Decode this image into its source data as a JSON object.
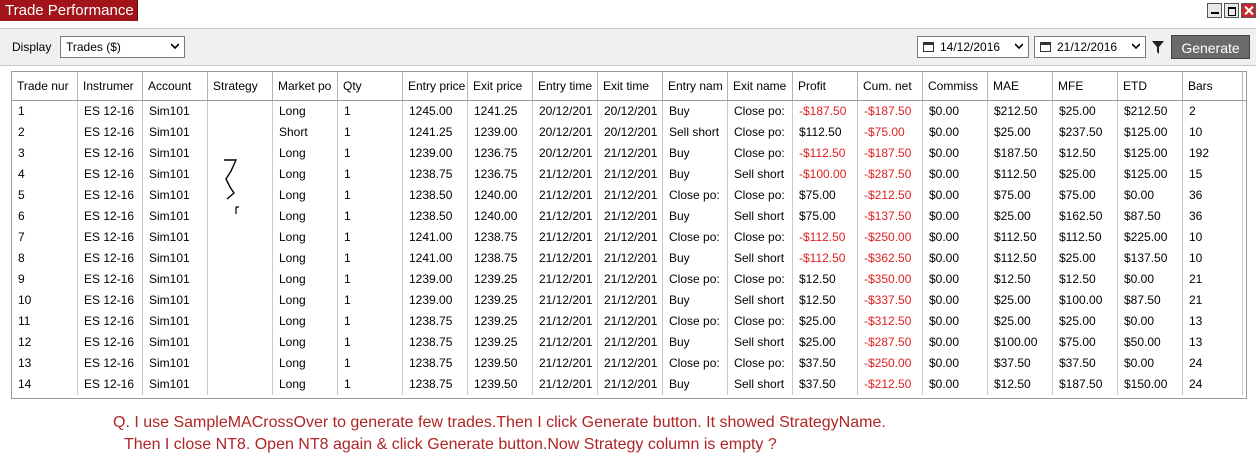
{
  "window": {
    "title": "Trade Performance"
  },
  "toolbar": {
    "display_label": "Display",
    "display_value": "Trades ($)",
    "from_date": "14/12/2016",
    "to_date": "21/12/2016",
    "generate_label": "Generate"
  },
  "columns": [
    "Trade nur",
    "Instrumer",
    "Account",
    "Strategy",
    "Market po",
    "Qty",
    "Entry price",
    "Exit price",
    "Entry time",
    "Exit time",
    "Entry nam",
    "Exit name",
    "Profit",
    "Cum. net",
    "Commiss",
    "MAE",
    "MFE",
    "ETD",
    "Bars"
  ],
  "rows": [
    [
      "1",
      "ES 12-16",
      "Sim101",
      "",
      "Long",
      "1",
      "1245.00",
      "1241.25",
      "20/12/201",
      "20/12/201",
      "Buy",
      "Close po:",
      "-$187.50",
      "-$187.50",
      "$0.00",
      "$212.50",
      "$25.00",
      "$212.50",
      "2"
    ],
    [
      "2",
      "ES 12-16",
      "Sim101",
      "",
      "Short",
      "1",
      "1241.25",
      "1239.00",
      "20/12/201",
      "20/12/201",
      "Sell short",
      "Close po:",
      "$112.50",
      "-$75.00",
      "$0.00",
      "$25.00",
      "$237.50",
      "$125.00",
      "10"
    ],
    [
      "3",
      "ES 12-16",
      "Sim101",
      "",
      "Long",
      "1",
      "1239.00",
      "1236.75",
      "20/12/201",
      "21/12/201",
      "Buy",
      "Close po:",
      "-$112.50",
      "-$187.50",
      "$0.00",
      "$187.50",
      "$12.50",
      "$125.00",
      "192"
    ],
    [
      "4",
      "ES 12-16",
      "Sim101",
      "",
      "Long",
      "1",
      "1238.75",
      "1236.75",
      "21/12/201",
      "21/12/201",
      "Buy",
      "Sell short",
      "-$100.00",
      "-$287.50",
      "$0.00",
      "$112.50",
      "$25.00",
      "$125.00",
      "15"
    ],
    [
      "5",
      "ES 12-16",
      "Sim101",
      "",
      "Long",
      "1",
      "1238.50",
      "1240.00",
      "21/12/201",
      "21/12/201",
      "Close po:",
      "Close po:",
      "$75.00",
      "-$212.50",
      "$0.00",
      "$75.00",
      "$75.00",
      "$0.00",
      "36"
    ],
    [
      "6",
      "ES 12-16",
      "Sim101",
      "",
      "Long",
      "1",
      "1238.50",
      "1240.00",
      "21/12/201",
      "21/12/201",
      "Buy",
      "Sell short",
      "$75.00",
      "-$137.50",
      "$0.00",
      "$25.00",
      "$162.50",
      "$87.50",
      "36"
    ],
    [
      "7",
      "ES 12-16",
      "Sim101",
      "",
      "Long",
      "1",
      "1241.00",
      "1238.75",
      "21/12/201",
      "21/12/201",
      "Close po:",
      "Close po:",
      "-$112.50",
      "-$250.00",
      "$0.00",
      "$112.50",
      "$112.50",
      "$225.00",
      "10"
    ],
    [
      "8",
      "ES 12-16",
      "Sim101",
      "",
      "Long",
      "1",
      "1241.00",
      "1238.75",
      "21/12/201",
      "21/12/201",
      "Buy",
      "Sell short",
      "-$112.50",
      "-$362.50",
      "$0.00",
      "$112.50",
      "$25.00",
      "$137.50",
      "10"
    ],
    [
      "9",
      "ES 12-16",
      "Sim101",
      "",
      "Long",
      "1",
      "1239.00",
      "1239.25",
      "21/12/201",
      "21/12/201",
      "Close po:",
      "Close po:",
      "$12.50",
      "-$350.00",
      "$0.00",
      "$12.50",
      "$12.50",
      "$0.00",
      "21"
    ],
    [
      "10",
      "ES 12-16",
      "Sim101",
      "",
      "Long",
      "1",
      "1239.00",
      "1239.25",
      "21/12/201",
      "21/12/201",
      "Buy",
      "Sell short",
      "$12.50",
      "-$337.50",
      "$0.00",
      "$25.00",
      "$100.00",
      "$87.50",
      "21"
    ],
    [
      "11",
      "ES 12-16",
      "Sim101",
      "",
      "Long",
      "1",
      "1238.75",
      "1239.25",
      "21/12/201",
      "21/12/201",
      "Close po:",
      "Close po:",
      "$25.00",
      "-$312.50",
      "$0.00",
      "$25.00",
      "$25.00",
      "$0.00",
      "13"
    ],
    [
      "12",
      "ES 12-16",
      "Sim101",
      "",
      "Long",
      "1",
      "1238.75",
      "1239.25",
      "21/12/201",
      "21/12/201",
      "Buy",
      "Sell short",
      "$25.00",
      "-$287.50",
      "$0.00",
      "$100.00",
      "$75.00",
      "$50.00",
      "13"
    ],
    [
      "13",
      "ES 12-16",
      "Sim101",
      "",
      "Long",
      "1",
      "1238.75",
      "1239.50",
      "21/12/201",
      "21/12/201",
      "Close po:",
      "Close po:",
      "$37.50",
      "-$250.00",
      "$0.00",
      "$37.50",
      "$37.50",
      "$0.00",
      "24"
    ],
    [
      "14",
      "ES 12-16",
      "Sim101",
      "",
      "Long",
      "1",
      "1238.75",
      "1239.50",
      "21/12/201",
      "21/12/201",
      "Buy",
      "Sell short",
      "$37.50",
      "-$212.50",
      "$0.00",
      "$12.50",
      "$187.50",
      "$150.00",
      "24"
    ]
  ],
  "question": {
    "line1": "Q. I use SampleMACrossOver to generate few trades.Then I click Generate button. It showed StrategyName.",
    "line2": "Then I close NT8. Open NT8 again & click Generate button.Now Strategy column is empty ?"
  },
  "colors": {
    "title_bg": "#a3141a",
    "negative": "#e02020",
    "question": "#b02525",
    "generate_bg": "#6a6a6a"
  }
}
